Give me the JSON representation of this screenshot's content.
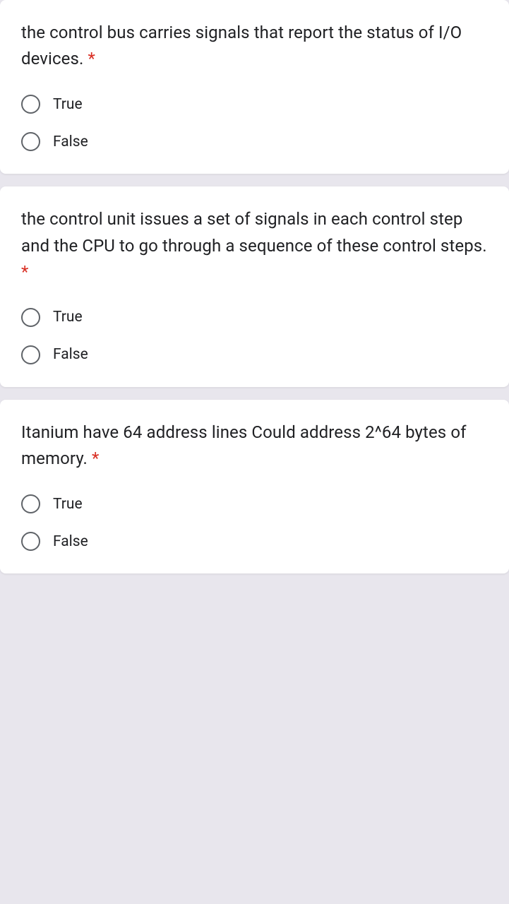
{
  "required_marker": "*",
  "questions": [
    {
      "text": "the control bus carries signals that report the status of I/O devices. ",
      "required": true,
      "options": [
        "True",
        "False"
      ]
    },
    {
      "text": "the control unit issues a set of signals in each control step and the CPU to go through a sequence of these control steps. ",
      "required": true,
      "options": [
        "True",
        "False"
      ]
    },
    {
      "text": "Itanium have 64 address lines Could address 2^64 bytes of memory. ",
      "required": true,
      "options": [
        "True",
        "False"
      ]
    }
  ]
}
